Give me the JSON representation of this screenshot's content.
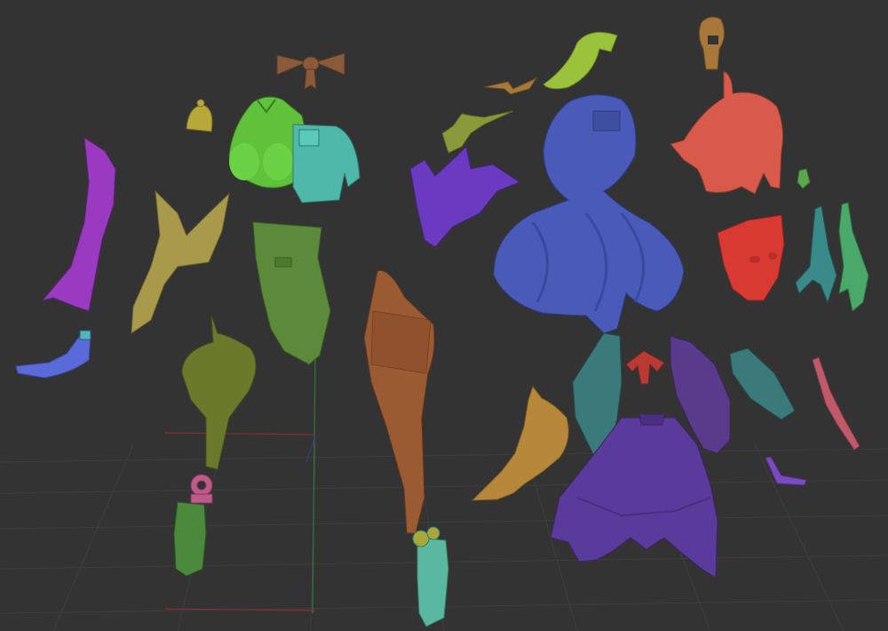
{
  "scene": {
    "background": "#333333",
    "grid_color": "#3d3d3d",
    "axis_x_color": "#8a2e2e",
    "axis_y_color": "#2e7a3a",
    "axis_z_color": "#3a3a8a"
  },
  "parts": [
    {
      "name": "bow-piece",
      "color": "#8a5a3a"
    },
    {
      "name": "bell-piece",
      "color": "#b8a83a"
    },
    {
      "name": "torso-piece",
      "color": "#5fc23a"
    },
    {
      "name": "jacket-piece",
      "color": "#4fb8a8"
    },
    {
      "name": "left-sleeve-piece",
      "color": "#9a3ac0"
    },
    {
      "name": "collar-cape-piece",
      "color": "#a89a4a"
    },
    {
      "name": "abdomen-piece",
      "color": "#5a8a3a"
    },
    {
      "name": "left-hand-piece",
      "color": "#5a6ad8"
    },
    {
      "name": "thigh-piece",
      "color": "#6a7a2a"
    },
    {
      "name": "boot-left-piece",
      "color": "#4a8a3a"
    },
    {
      "name": "flower-piece",
      "color": "#c05a8a"
    },
    {
      "name": "leg-piece",
      "color": "#9a5a32"
    },
    {
      "name": "boot-right-piece",
      "color": "#5ab8a0"
    },
    {
      "name": "moth-piece",
      "color": "#a8783a"
    },
    {
      "name": "leaf-piece",
      "color": "#9ac23a"
    },
    {
      "name": "right-hand-piece",
      "color": "#8a9a3a"
    },
    {
      "name": "right-sleeve-piece",
      "color": "#6a3ac0"
    },
    {
      "name": "hair-back-piece",
      "color": "#4a5ab8"
    },
    {
      "name": "small-head-piece",
      "color": "#a8783a"
    },
    {
      "name": "hair-front-piece",
      "color": "#d85a4a"
    },
    {
      "name": "face-piece",
      "color": "#d83a32"
    },
    {
      "name": "tiny-green-piece",
      "color": "#5aa84a"
    },
    {
      "name": "hair-strand-teal-piece",
      "color": "#3a8a8a"
    },
    {
      "name": "hair-strand-green-piece",
      "color": "#4aa86a"
    },
    {
      "name": "skirt-panel-teal-piece",
      "color": "#3a7a7a"
    },
    {
      "name": "skirt-piece",
      "color": "#5a3a9a"
    },
    {
      "name": "skirt-panel-purple-piece",
      "color": "#5a3a8a"
    },
    {
      "name": "red-ornament-piece",
      "color": "#b83a32"
    },
    {
      "name": "side-panel-teal-piece",
      "color": "#3a7a7a"
    },
    {
      "name": "pink-ribbon-piece",
      "color": "#c05a6a"
    },
    {
      "name": "gold-cape-piece",
      "color": "#b8883a"
    },
    {
      "name": "small-purple-piece",
      "color": "#7a4ac0"
    }
  ]
}
